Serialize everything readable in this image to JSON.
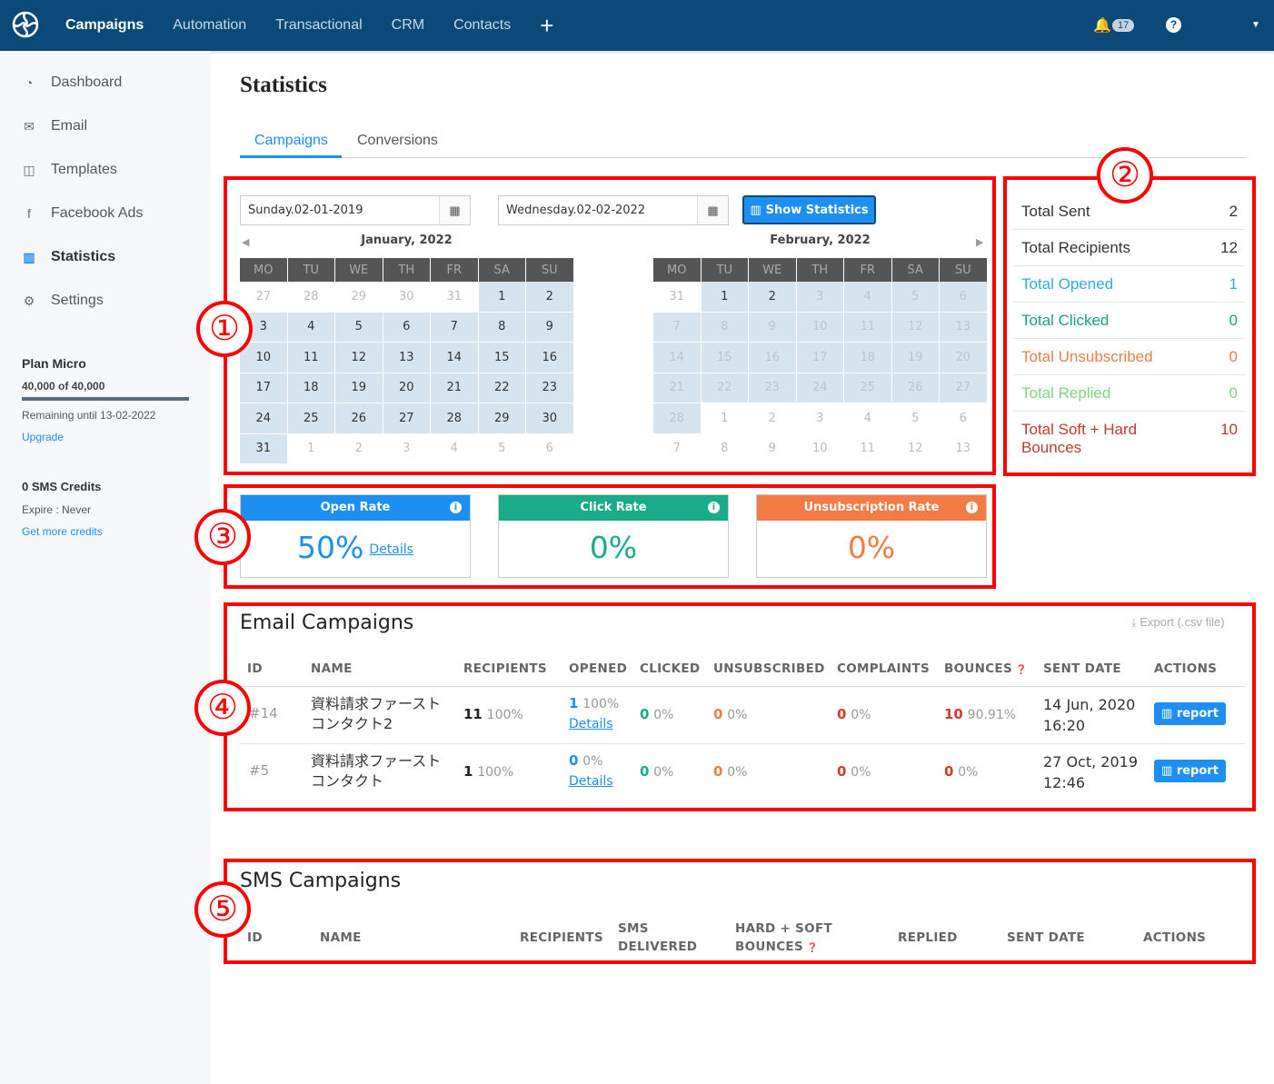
{
  "topbar": {
    "nav": [
      "Campaigns",
      "Automation",
      "Transactional",
      "CRM",
      "Contacts"
    ],
    "add_label": "+",
    "notifications": "17",
    "help": "?"
  },
  "sidebar": {
    "items": [
      {
        "label": "Dashboard",
        "icon": "dashboard-icon",
        "glyph": "◔"
      },
      {
        "label": "Email",
        "icon": "envelope-icon",
        "glyph": "✉"
      },
      {
        "label": "Templates",
        "icon": "template-icon",
        "glyph": "◫"
      },
      {
        "label": "Facebook Ads",
        "icon": "facebook-icon",
        "glyph": "f"
      },
      {
        "label": "Statistics",
        "icon": "bar-chart-icon",
        "glyph": "▥"
      },
      {
        "label": "Settings",
        "icon": "gear-icon",
        "glyph": "⚙"
      }
    ],
    "plan": {
      "name": "Plan Micro",
      "usage": "40,000 of 40,000",
      "usage_fraction": 1.0,
      "remaining": "Remaining until 13-02-2022",
      "upgrade": "Upgrade"
    },
    "sms": {
      "credits": "0 SMS Credits",
      "expire": "Expire : Never",
      "more": "Get more credits"
    }
  },
  "page": {
    "title": "Statistics",
    "tabs": [
      "Campaigns",
      "Conversions"
    ]
  },
  "filters": {
    "start_date": "Sunday.02-01-2019",
    "end_date": "Wednesday.02-02-2022",
    "show_button": "Show Statistics"
  },
  "calendars": [
    {
      "month": "January, 2022",
      "weekdays": [
        "MO",
        "TU",
        "WE",
        "TH",
        "FR",
        "SA",
        "SU"
      ],
      "weeks": [
        [
          [
            "27",
            "o"
          ],
          [
            "28",
            "o"
          ],
          [
            "29",
            "o"
          ],
          [
            "30",
            "o"
          ],
          [
            "31",
            "o"
          ],
          [
            "1",
            "s"
          ],
          [
            "2",
            "s"
          ]
        ],
        [
          [
            "3",
            "s"
          ],
          [
            "4",
            "s"
          ],
          [
            "5",
            "s"
          ],
          [
            "6",
            "s"
          ],
          [
            "7",
            "s"
          ],
          [
            "8",
            "s"
          ],
          [
            "9",
            "s"
          ]
        ],
        [
          [
            "10",
            "s"
          ],
          [
            "11",
            "s"
          ],
          [
            "12",
            "s"
          ],
          [
            "13",
            "s"
          ],
          [
            "14",
            "s"
          ],
          [
            "15",
            "s"
          ],
          [
            "16",
            "s"
          ]
        ],
        [
          [
            "17",
            "s"
          ],
          [
            "18",
            "s"
          ],
          [
            "19",
            "s"
          ],
          [
            "20",
            "s"
          ],
          [
            "21",
            "s"
          ],
          [
            "22",
            "s"
          ],
          [
            "23",
            "s"
          ]
        ],
        [
          [
            "24",
            "s"
          ],
          [
            "25",
            "s"
          ],
          [
            "26",
            "s"
          ],
          [
            "27",
            "s"
          ],
          [
            "28",
            "s"
          ],
          [
            "29",
            "s"
          ],
          [
            "30",
            "s"
          ]
        ],
        [
          [
            "31",
            "s"
          ],
          [
            "1",
            "o"
          ],
          [
            "2",
            "o"
          ],
          [
            "3",
            "o"
          ],
          [
            "4",
            "o"
          ],
          [
            "5",
            "o"
          ],
          [
            "6",
            "o"
          ]
        ]
      ]
    },
    {
      "month": "February, 2022",
      "weekdays": [
        "MO",
        "TU",
        "WE",
        "TH",
        "FR",
        "SA",
        "SU"
      ],
      "weeks": [
        [
          [
            "31",
            "o"
          ],
          [
            "1",
            "s"
          ],
          [
            "2",
            "s"
          ],
          [
            "3",
            "d"
          ],
          [
            "4",
            "d"
          ],
          [
            "5",
            "d"
          ],
          [
            "6",
            "d"
          ]
        ],
        [
          [
            "7",
            "d"
          ],
          [
            "8",
            "d"
          ],
          [
            "9",
            "d"
          ],
          [
            "10",
            "d"
          ],
          [
            "11",
            "d"
          ],
          [
            "12",
            "d"
          ],
          [
            "13",
            "d"
          ]
        ],
        [
          [
            "14",
            "d"
          ],
          [
            "15",
            "d"
          ],
          [
            "16",
            "d"
          ],
          [
            "17",
            "d"
          ],
          [
            "18",
            "d"
          ],
          [
            "19",
            "d"
          ],
          [
            "20",
            "d"
          ]
        ],
        [
          [
            "21",
            "d"
          ],
          [
            "22",
            "d"
          ],
          [
            "23",
            "d"
          ],
          [
            "24",
            "d"
          ],
          [
            "25",
            "d"
          ],
          [
            "26",
            "d"
          ],
          [
            "27",
            "d"
          ]
        ],
        [
          [
            "28",
            "d"
          ],
          [
            "1",
            "o"
          ],
          [
            "2",
            "o"
          ],
          [
            "3",
            "o"
          ],
          [
            "4",
            "o"
          ],
          [
            "5",
            "o"
          ],
          [
            "6",
            "o"
          ]
        ],
        [
          [
            "7",
            "o"
          ],
          [
            "8",
            "o"
          ],
          [
            "9",
            "o"
          ],
          [
            "10",
            "o"
          ],
          [
            "11",
            "o"
          ],
          [
            "12",
            "o"
          ],
          [
            "13",
            "o"
          ]
        ]
      ]
    }
  ],
  "totals": [
    {
      "label": "Total Sent",
      "value": "2",
      "color": "#333333"
    },
    {
      "label": "Total Recipients",
      "value": "12",
      "color": "#333333"
    },
    {
      "label": "Total Opened",
      "value": "1",
      "color": "#2ab0d9"
    },
    {
      "label": "Total Clicked",
      "value": "0",
      "color": "#16a085"
    },
    {
      "label": "Total Unsubscribed",
      "value": "0",
      "color": "#f07c4a"
    },
    {
      "label": "Total Replied",
      "value": "0",
      "color": "#7fd67f"
    },
    {
      "label": "Total Soft + Hard Bounces",
      "value": "10",
      "color": "#c0392b"
    }
  ],
  "rates": [
    {
      "label": "Open Rate",
      "value": "50%",
      "details": "Details",
      "color": "#1d8ff2"
    },
    {
      "label": "Click Rate",
      "value": "0%",
      "color": "#1aab8a"
    },
    {
      "label": "Unsubscription Rate",
      "value": "0%",
      "color": "#f47b43"
    }
  ],
  "email_campaigns": {
    "title": "Email Campaigns",
    "export": "Export (.csv file)",
    "columns": [
      "ID",
      "NAME",
      "RECIPIENTS",
      "OPENED",
      "CLICKED",
      "UNSUBSCRIBED",
      "COMPLAINTS",
      "BOUNCES",
      "SENT DATE",
      "ACTIONS"
    ],
    "rows": [
      {
        "id": "#14",
        "name": "資料請求ファースト コンタクト2",
        "recipients": "11",
        "recipients_pct": "100%",
        "opened": "1",
        "opened_pct": "100%",
        "details": "Details",
        "clicked": "0",
        "clicked_pct": "0%",
        "unsub": "0",
        "unsub_pct": "0%",
        "complaints": "0",
        "complaints_pct": "0%",
        "bounces": "10",
        "bounces_pct": "90.91%",
        "date": "14 Jun, 2020",
        "time": "16:20",
        "action": "report"
      },
      {
        "id": "#5",
        "name": "資料請求ファースト コンタクト",
        "recipients": "1",
        "recipients_pct": "100%",
        "opened": "0",
        "opened_pct": "0%",
        "details": "Details",
        "clicked": "0",
        "clicked_pct": "0%",
        "unsub": "0",
        "unsub_pct": "0%",
        "complaints": "0",
        "complaints_pct": "0%",
        "bounces": "0",
        "bounces_pct": "0%",
        "date": "27 Oct, 2019",
        "time": "12:46",
        "action": "report"
      }
    ]
  },
  "sms_campaigns": {
    "title": "SMS Campaigns",
    "columns": [
      "ID",
      "NAME",
      "RECIPIENTS",
      "SMS DELIVERED",
      "HARD + SOFT BOUNCES",
      "REPLIED",
      "SENT DATE",
      "ACTIONS"
    ]
  },
  "annotations": [
    "①",
    "②",
    "③",
    "④",
    "⑤"
  ]
}
